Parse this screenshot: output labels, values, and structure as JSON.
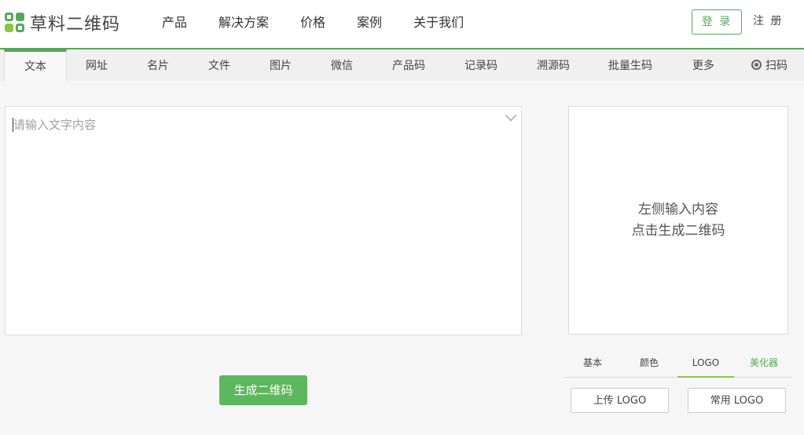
{
  "brand": {
    "name": "草料二维码"
  },
  "topnav": [
    {
      "label": "产品"
    },
    {
      "label": "解决方案"
    },
    {
      "label": "价格"
    },
    {
      "label": "案例"
    },
    {
      "label": "关于我们"
    }
  ],
  "auth": {
    "login": "登 录",
    "register": "注 册"
  },
  "tabs": [
    {
      "label": "文本",
      "active": true
    },
    {
      "label": "网址"
    },
    {
      "label": "名片"
    },
    {
      "label": "文件"
    },
    {
      "label": "图片"
    },
    {
      "label": "微信"
    },
    {
      "label": "产品码"
    },
    {
      "label": "记录码"
    },
    {
      "label": "溯源码"
    },
    {
      "label": "批量生码"
    },
    {
      "label": "更多"
    },
    {
      "label": "扫码",
      "icon": "scan-icon"
    }
  ],
  "editor": {
    "placeholder": "请输入文字内容",
    "value": ""
  },
  "generate_label": "生成二维码",
  "preview": {
    "line1": "左侧输入内容",
    "line2": "点击生成二维码"
  },
  "subtabs": [
    {
      "label": "基本"
    },
    {
      "label": "颜色"
    },
    {
      "label": "LOGO",
      "selected": true
    },
    {
      "label": "美化器",
      "color": "#58a85c"
    }
  ],
  "logo_buttons": {
    "upload": "上传 LOGO",
    "common": "常用 LOGO"
  },
  "colors": {
    "accent": "#58a85c",
    "button": "#5cb85c",
    "underline": "#8cc63f"
  }
}
